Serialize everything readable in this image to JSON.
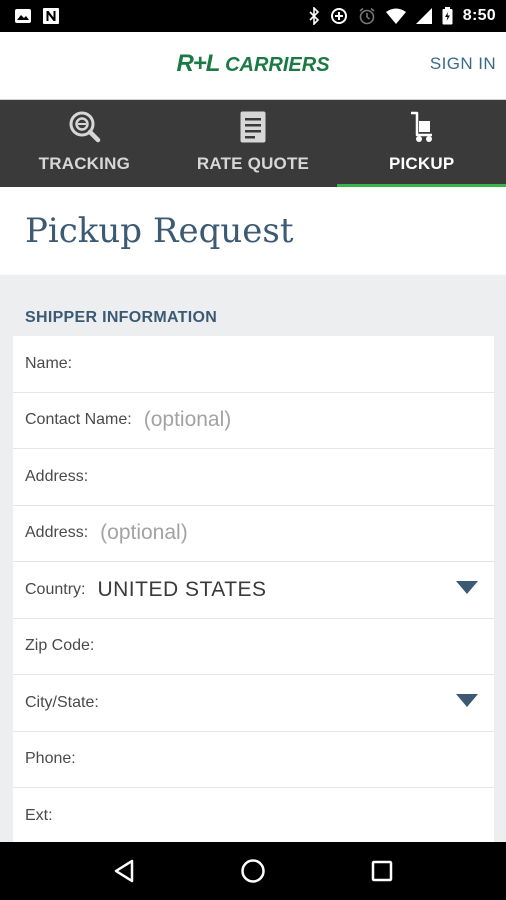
{
  "status_bar": {
    "time": "8:50",
    "left_icons": [
      "image-icon",
      "n-notification-icon"
    ],
    "right_icons": [
      "bluetooth-icon",
      "data-saver-icon",
      "alarm-icon",
      "wifi-icon",
      "cell-signal-icon",
      "battery-icon"
    ]
  },
  "header": {
    "logo_mark": "R+L",
    "logo_text": "CARRIERS",
    "sign_in": "SIGN IN"
  },
  "tabs": [
    {
      "label": "TRACKING",
      "icon": "tracking-search-icon",
      "active": false
    },
    {
      "label": "RATE QUOTE",
      "icon": "document-icon",
      "active": false
    },
    {
      "label": "PICKUP",
      "icon": "cart-icon",
      "active": true
    }
  ],
  "page": {
    "title": "Pickup Request"
  },
  "shipper_section": {
    "header": "SHIPPER INFORMATION",
    "fields": {
      "name": {
        "label": "Name:"
      },
      "contact_name": {
        "label": "Contact Name:",
        "placeholder": "(optional)"
      },
      "address1": {
        "label": "Address:"
      },
      "address2": {
        "label": "Address:",
        "placeholder": "(optional)"
      },
      "country": {
        "label": "Country:",
        "value": "UNITED STATES"
      },
      "zip": {
        "label": "Zip Code:"
      },
      "city_state": {
        "label": "City/State:"
      },
      "phone": {
        "label": "Phone:"
      },
      "ext": {
        "label": "Ext:"
      }
    }
  },
  "colors": {
    "brand_green": "#1b7a43",
    "accent_green": "#39b54a",
    "title_blue": "#3c5a73",
    "tab_bg": "#3a3a3a",
    "dropdown_arrow": "#3c5a73"
  },
  "nav_bar": {
    "buttons": [
      "back-icon",
      "home-icon",
      "recents-icon"
    ]
  }
}
